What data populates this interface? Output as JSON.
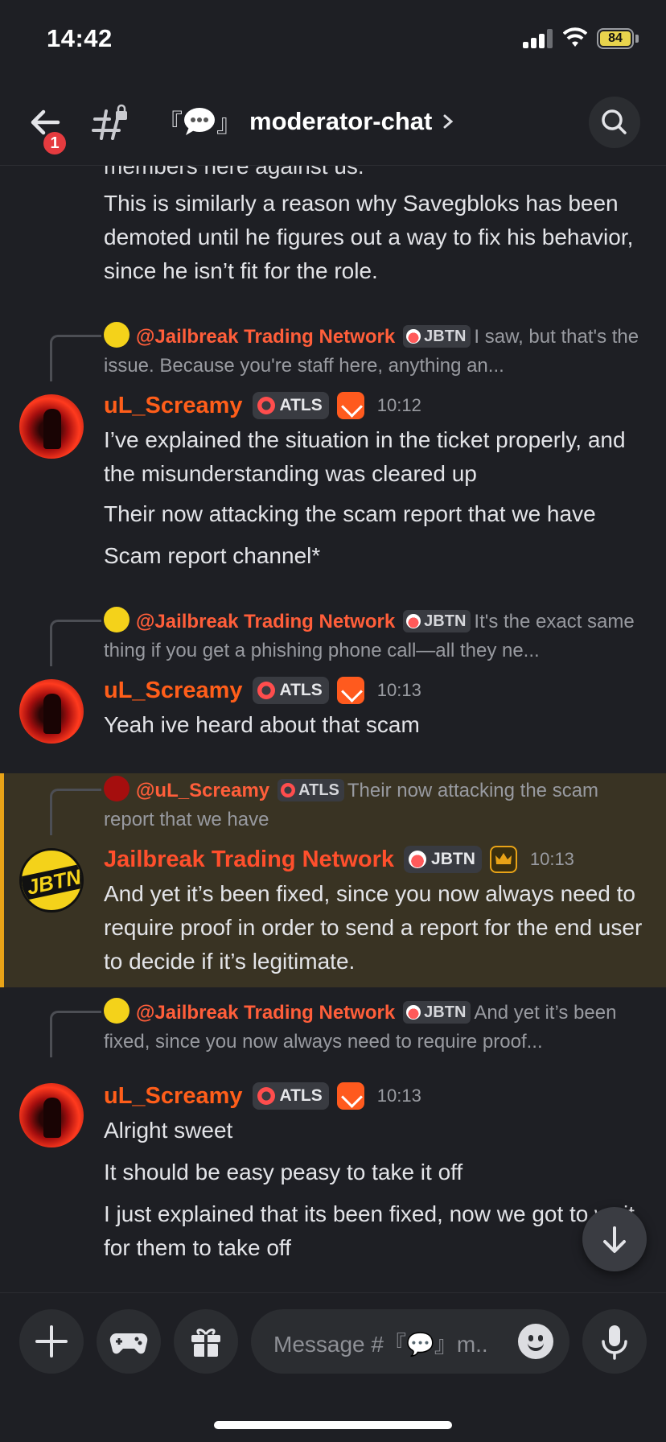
{
  "status": {
    "time": "14:42",
    "battery": "84"
  },
  "header": {
    "unread_count": "1",
    "bracket_left": "『",
    "bracket_right": "』",
    "channel_name": "moderator-chat"
  },
  "messages": [
    {
      "type": "continuation",
      "cut_line": "members here against us.",
      "text": "This is similarly a reason why Savegbloks has been demoted until he figures out a way to fix his behavior, since he isn’t fit for the role."
    },
    {
      "reply": {
        "author": "@Jailbreak Trading Network",
        "tag": "JBTN",
        "snippet": "I saw, but that's the issue. Because you're staff here, anything an..."
      },
      "author": "uL_Screamy",
      "role": "ATLS",
      "time": "10:12",
      "lines": [
        "I’ve explained the situation in the ticket properly, and the misunderstanding was cleared up",
        "Their now attacking the scam report that we have",
        "Scam report channel*"
      ]
    },
    {
      "reply": {
        "author": "@Jailbreak Trading Network",
        "tag": "JBTN",
        "snippet": "It's the exact same thing if you get a phishing phone call—all they ne..."
      },
      "author": "uL_Screamy",
      "role": "ATLS",
      "time": "10:13",
      "lines": [
        "Yeah ive heard about that scam"
      ]
    },
    {
      "reply": {
        "author": "@uL_Screamy",
        "tag": "ATLS",
        "snippet": "Their now attacking the scam report that we have"
      },
      "author": "Jailbreak Trading Network",
      "role": "JBTN",
      "time": "10:13",
      "avatar_text": "JBTN",
      "lines": [
        "And yet it’s been fixed, since you now always need to require proof in order to send a report for the end user to decide if it’s legitimate."
      ]
    },
    {
      "reply": {
        "author": "@Jailbreak Trading Network",
        "tag": "JBTN",
        "snippet": "And yet it’s been fixed, since you now always need to require proof..."
      },
      "author": "uL_Screamy",
      "role": "ATLS",
      "time": "10:13",
      "lines": [
        "Alright sweet",
        "It should be easy peasy to take it off",
        "I just explained that its been fixed, now we got to wait for them to take off"
      ]
    }
  ],
  "composer": {
    "placeholder": "Message #『💬』m.."
  },
  "colors": {
    "background": "#1e1f24",
    "author_orange": "#ff5e1a",
    "highlight": "#393323",
    "highlight_bar": "#e8a317"
  },
  "icons": [
    "back-arrow-icon",
    "channel-lock-icon",
    "search-icon",
    "chevron-right-icon",
    "plus-icon",
    "gamepad-icon",
    "gift-icon",
    "emoji-icon",
    "microphone-icon",
    "arrow-down-icon"
  ]
}
